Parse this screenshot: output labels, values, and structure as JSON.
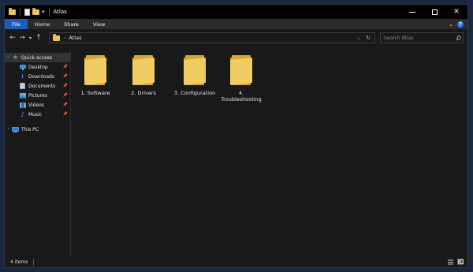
{
  "window": {
    "title": "Atlas",
    "controls": [
      "minimize",
      "maximize",
      "close"
    ]
  },
  "ribbon": {
    "tabs": [
      "File",
      "Home",
      "Share",
      "View"
    ]
  },
  "address": {
    "path": [
      "Atlas"
    ],
    "search_placeholder": "Search Atlas"
  },
  "sidebar": {
    "quick_access": "Quick access",
    "items": [
      {
        "label": "Desktop",
        "icon": "desktop-icon",
        "pinned": true
      },
      {
        "label": "Downloads",
        "icon": "download-icon",
        "pinned": true
      },
      {
        "label": "Documents",
        "icon": "documents-icon",
        "pinned": true
      },
      {
        "label": "Pictures",
        "icon": "pictures-icon",
        "pinned": true
      },
      {
        "label": "Videos",
        "icon": "videos-icon",
        "pinned": true
      },
      {
        "label": "Music",
        "icon": "music-icon",
        "pinned": true
      }
    ],
    "this_pc": "This PC"
  },
  "folders": [
    {
      "name": "1. Software"
    },
    {
      "name": "2. Drivers"
    },
    {
      "name": "3. Configuration"
    },
    {
      "name": "4. Troubleshooting"
    }
  ],
  "status": {
    "item_count": "4 items"
  },
  "colors": {
    "window_bg": "#191919",
    "accent": "#1a5fb4",
    "folder": "#f0cc65"
  }
}
